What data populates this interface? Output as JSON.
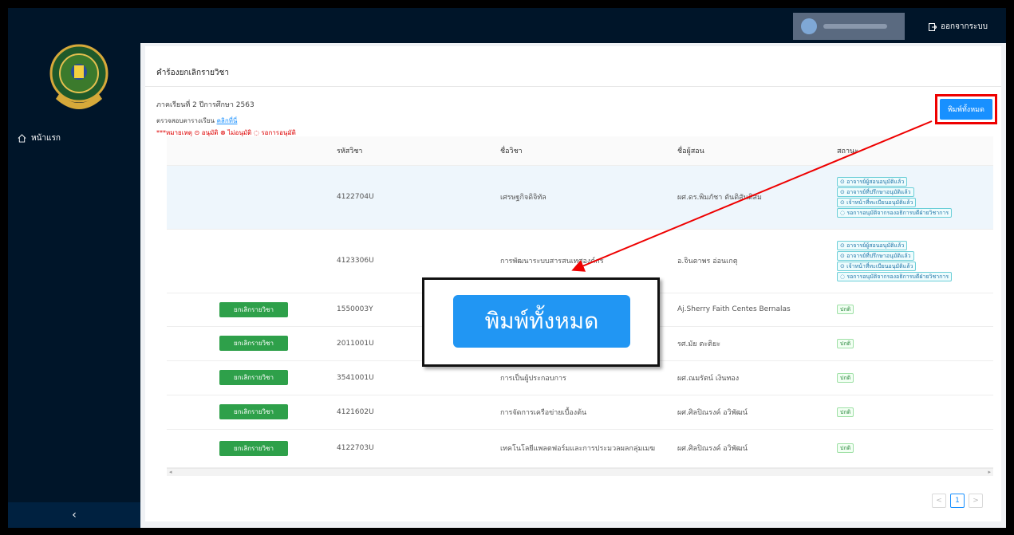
{
  "header": {
    "logout_label": "ออกจากระบบ"
  },
  "sidebar": {
    "home_label": "หน้าแรก",
    "collapse_icon": "‹"
  },
  "page": {
    "title": "คำร้องยกเลิกรายวิชา",
    "term": "ภาคเรียนที่ 2 ปีการศึกษา 2563",
    "check_text": "ตรวจสอบตารางเรียน",
    "check_link": "คลิกที่นี่",
    "note": "***หมายเหตุ ⊙ อนุมัติ ⊗ ไม่อนุมัติ ◌ รอการอนุมัติ",
    "print_all": "พิมพ์ทั้งหมด",
    "zoom_label": "พิมพ์ทั้งหมด"
  },
  "table": {
    "headers": [
      "",
      "รหัสวิชา",
      "ชื่อวิชา",
      "ชื่อผู้สอน",
      "สถานะ"
    ],
    "cancel_label": "ยกเลิกรายวิชา",
    "rows": [
      {
        "code": "4122704U",
        "name": "เศรษฐกิจดิจิทัล",
        "teacher": "ผศ.ดร.พิมภัชา ตันติสันติสม",
        "tags": [
          "⊙ อาจารย์ผู้สอนอนุมัติแล้ว",
          "⊙ อาจารย์ที่ปรึกษาอนุมัติแล้ว",
          "⊙ เจ้าหน้าที่ทะเบียนอนุมัติแล้ว",
          "◌ รอการอนุมัติจากรองอธิการบดีฝ่ายวิชาการ"
        ]
      },
      {
        "code": "4123306U",
        "name": "การพัฒนาระบบสารสนเทศองค์กร",
        "teacher": "อ.จินดาพร อ่อนเกตุ",
        "tags": [
          "⊙ อาจารย์ผู้สอนอนุมัติแล้ว",
          "⊙ อาจารย์ที่ปรึกษาอนุมัติแล้ว",
          "⊙ เจ้าหน้าที่ทะเบียนอนุมัติแล้ว",
          "◌ รอการอนุมัติจากรองอธิการบดีฝ่ายวิชาการ"
        ]
      },
      {
        "code": "1550003Y",
        "name": "",
        "teacher": "Aj.Sherry Faith Centes Bernalas",
        "status": "ปกติ"
      },
      {
        "code": "2011001U",
        "name": "",
        "teacher": "รศ.มัย ตะติยะ",
        "status": "ปกติ"
      },
      {
        "code": "3541001U",
        "name": "การเป็นผู้ประกอบการ",
        "teacher": "ผศ.ณมรัตน์ เงินทอง",
        "status": "ปกติ"
      },
      {
        "code": "4121602U",
        "name": "การจัดการเครือข่ายเบื้องต้น",
        "teacher": "ผศ.ศิลปิณรงค์ อวิพัฒน์",
        "status": "ปกติ"
      },
      {
        "code": "4122703U",
        "name": "เทคโนโลยีแพลตฟอร์มและการประมวลผลกลุ่มเมฆ",
        "teacher": "ผศ.ศิลปิณรงค์ อวิพัฒน์",
        "status": "ปกติ"
      }
    ]
  },
  "pagination": {
    "prev": "<",
    "current": "1",
    "next": ">"
  },
  "colors": {
    "sidebar_bg": "#001529",
    "primary": "#1890ff",
    "cancel_btn": "#2ea04a",
    "highlight": "#e00000"
  }
}
